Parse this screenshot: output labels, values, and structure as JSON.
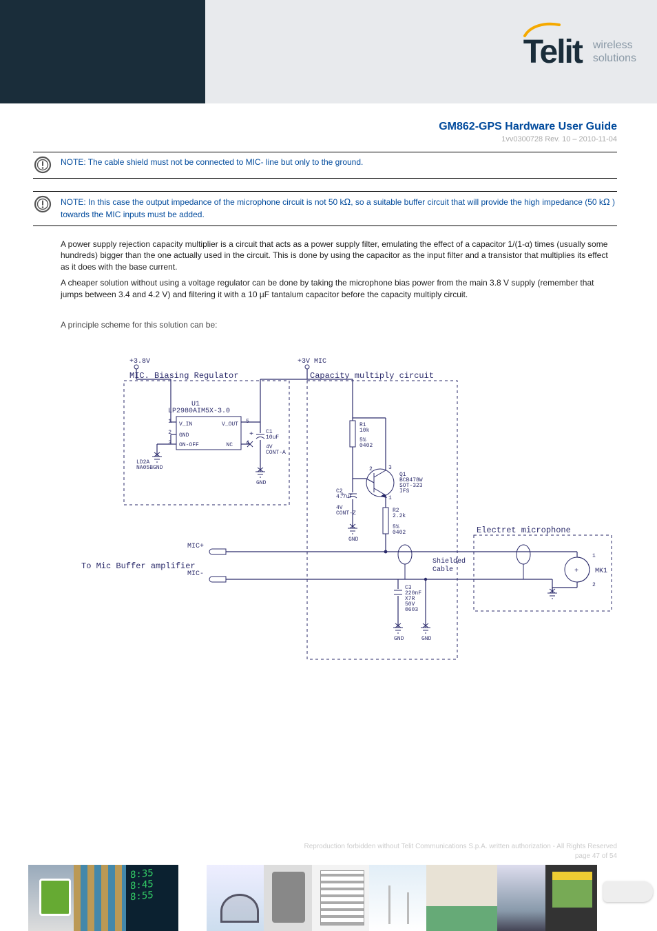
{
  "brand": {
    "name": "Telit",
    "tagline_l1": "wireless",
    "tagline_l2": "solutions"
  },
  "doc": {
    "title": "GM862-GPS Hardware User Guide",
    "code": "1vv0300728 Rev. 10  –  2010-11-04",
    "footer_line1": "Reproduction forbidden without Telit Communications S.p.A. written authorization - All Rights Reserved",
    "footer_line2": "page 47 of 54"
  },
  "notes": {
    "n1": "NOTE:  The cable shield must not be connected to MIC- line but only to the ground.",
    "n2_pre": "NOTE:  In this case the output impedance of the microphone circuit is not 50 k",
    "n2_mid": ", so a suitable buffer circuit that will provide the high impedance (50 k",
    "n2_post": " ) towards the MIC inputs must be added."
  },
  "body": {
    "p1": "A power supply rejection capacity multiplier is a circuit that acts as a power supply filter, emulating the effect of a capacitor 1/(1-α) times (usually some hundreds) bigger than the one actually used in the circuit. This is done by using the capacitor as the input filter and a transistor that multiplies its effect as it does with the base current.",
    "p2": "A cheaper solution without using a voltage regulator can be done by taking the microphone bias power from the main 3.8 V supply (remember that jumps between 3.4 and 4.2 V) and filtering it with a 10 µF tantalum capacitor before the capacity multiply circuit.",
    "hdr": "A principle scheme for this solution can be:"
  },
  "schematic": {
    "rail_in": "+3.8V",
    "rail_mic": "+3V MIC",
    "block_reg": "MIC. Biasing Regulator",
    "block_cap": "Capacity multiply circuit",
    "block_mic": "Electret microphone",
    "u1_ref": "U1",
    "u1_part": "LP2980AIM5X-3.0",
    "u1_pkg_l1": "LD2A",
    "u1_pkg_l2": "NA05B",
    "u1_pins": {
      "vin": "V_IN",
      "vout": "V_OUT",
      "gnd": "GND",
      "onoff": "ON-OFF",
      "nc": "NC"
    },
    "pinno": {
      "p1": "1",
      "p2": "2",
      "p3": "3",
      "p4": "4",
      "p5": "5"
    },
    "c1_ref": "C1",
    "c1_val": "10uF",
    "c1_v": "4V",
    "c1_pkg": "CONT-A",
    "c2_ref": "C2",
    "c2_val": "4.7uF",
    "c2_v": "4V",
    "c2_pkg": "CONT-Z",
    "c3_ref": "C3",
    "c3_val": "220nF",
    "c3_d": "X7R",
    "c3_v": "50V",
    "c3_pkg": "0603",
    "r1_ref": "R1",
    "r1_val": "10k",
    "r1_tol": "5%",
    "r1_pkg": "0402",
    "r2_ref": "R2",
    "r2_val": "2.2k",
    "r2_tol": "5%",
    "r2_pkg": "0402",
    "q1_ref": "Q1",
    "q1_part": "BCB478W",
    "q1_pkg": "SOT-323",
    "q1_fab": "IFS",
    "mk1": "MK1",
    "mic_plus": "MIC+",
    "mic_minus": "MIC-",
    "to_buf": "To Mic Buffer amplifier",
    "shielded": "Shielded",
    "cable": "Cable",
    "gnd": "GND",
    "q_pins": {
      "e": "1",
      "b": "2",
      "c": "3"
    },
    "mic_pins": {
      "top": "1",
      "bot": "2"
    }
  }
}
